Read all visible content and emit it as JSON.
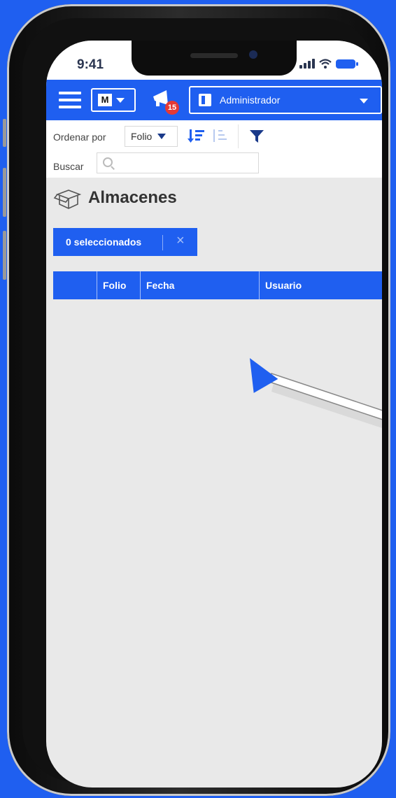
{
  "status_bar": {
    "time": "9:41"
  },
  "topbar": {
    "m_dropdown_label": "M",
    "notification_count": "15",
    "role_label": "Administrador"
  },
  "toolbar": {
    "sort_label": "Ordenar por",
    "sort_value": "Folio",
    "search_label": "Buscar",
    "search_value": ""
  },
  "page": {
    "title": "Almacenes"
  },
  "selection": {
    "label": "0 seleccionados",
    "clear": "×"
  },
  "table": {
    "headers": [
      "",
      "Folio",
      "Fecha",
      "Usuario"
    ]
  },
  "colors": {
    "primary": "#1f5ff0",
    "badge": "#e53935",
    "background": "#e9e9e9"
  }
}
